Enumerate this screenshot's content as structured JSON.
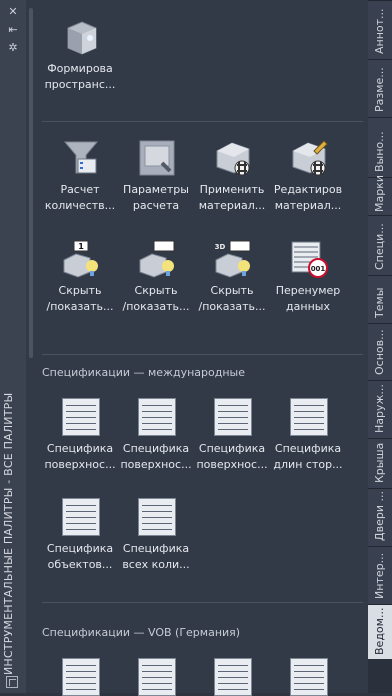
{
  "palette": {
    "title": "ИНСТРУМЕНТАЛЬНЫЕ ПАЛИТРЫ - ВСЕ ПАЛИТРЫ"
  },
  "tools_top": [
    {
      "label1": "Формирова",
      "label2": "пространс..."
    }
  ],
  "tools_row1": [
    {
      "label1": "Расчет",
      "label2": "количеств..."
    },
    {
      "label1": "Параметры",
      "label2": "расчета"
    },
    {
      "label1": "Применить",
      "label2": "материал..."
    },
    {
      "label1": "Редактиров",
      "label2": "материал..."
    }
  ],
  "tools_row2": [
    {
      "label1": "Скрыть",
      "label2": "/показать..."
    },
    {
      "label1": "Скрыть",
      "label2": "/показать..."
    },
    {
      "label1": "Скрыть",
      "label2": "/показать..."
    },
    {
      "label1": "Перенумер",
      "label2": "данных"
    }
  ],
  "section_intl": {
    "title": "Спецификации — международные",
    "tools": [
      {
        "label1": "Специфика",
        "label2": "поверхнос..."
      },
      {
        "label1": "Специфика",
        "label2": "поверхнос..."
      },
      {
        "label1": "Специфика",
        "label2": "поверхнос..."
      },
      {
        "label1": "Специфика",
        "label2": "длин стор..."
      },
      {
        "label1": "Специфика",
        "label2": "объектов..."
      },
      {
        "label1": "Специфика",
        "label2": "всех коли..."
      }
    ]
  },
  "section_vob": {
    "title": "Спецификации — VOB (Германия)"
  },
  "tabs": [
    {
      "label": "Аннот..."
    },
    {
      "label": "Разме..."
    },
    {
      "label": "Выно..."
    },
    {
      "label": "Марки"
    },
    {
      "label": "Специ..."
    },
    {
      "label": "Темы"
    },
    {
      "label": "Основ..."
    },
    {
      "label": "Наруж..."
    },
    {
      "label": "Крыша"
    },
    {
      "label": "Двери ..."
    },
    {
      "label": "Интер..."
    },
    {
      "label": "Ведом..."
    }
  ],
  "badges": {
    "marker": "001",
    "hide1": "1",
    "hide3": "3D"
  },
  "colors": {
    "bg": "#323947",
    "text": "#e6e9ee",
    "active_tab": "#d9dde4"
  }
}
